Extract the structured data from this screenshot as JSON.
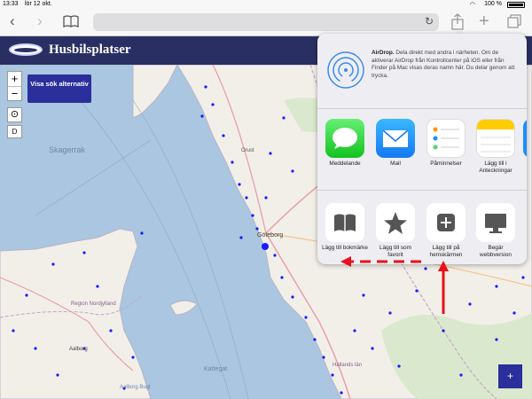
{
  "status_bar": {
    "time": "13:33",
    "day": "lör 12 okt.",
    "battery": "100 %"
  },
  "browser": {
    "back_icon": "chevron-left-icon",
    "forward_icon": "chevron-right-icon",
    "bookmarks_icon": "book-icon",
    "reload_icon": "reload-icon",
    "share_icon": "share-icon",
    "new_tab_icon": "plus-icon",
    "tabs_icon": "tabs-icon"
  },
  "site": {
    "title": "Husbilsplatser",
    "accent": "#2a2f63",
    "button_color": "#2a2f9c"
  },
  "map_controls": {
    "zoom_in": "+",
    "zoom_out": "−",
    "layer_label": "D",
    "search_button": "Visa sök alternativ"
  },
  "map_labels": {
    "skagerrak": "Skagerrak",
    "orust": "Orust",
    "goteborg": "Göteborg",
    "region_nordjylland": "Region Nordjylland",
    "aalborg": "Aalborg",
    "aalborg_bugt": "Aalborg Bugt",
    "kattegat": "Kattegat",
    "hallands_lan": "Hallands län"
  },
  "share_sheet": {
    "airdrop_title": "AirDrop.",
    "airdrop_text": "Dela direkt med andra i närheten. Om de aktiverar AirDrop från Kontrollcenter på iOS eller från Finder på Mac visas deras namn här. Du delar genom att trycka.",
    "apps": [
      {
        "label": "Meddelande",
        "icon": "messages-icon"
      },
      {
        "label": "Mail",
        "icon": "mail-icon"
      },
      {
        "label": "Påminnelser",
        "icon": "reminders-icon"
      },
      {
        "label": "Lägg till i Anteckningar",
        "icon": "notes-icon"
      }
    ],
    "actions": [
      {
        "label": "Lägg till bokmärke",
        "icon": "book-icon"
      },
      {
        "label": "Lägg till som favorit",
        "icon": "star-icon"
      },
      {
        "label": "Lägg till på hemskärmen",
        "icon": "plus-square-icon"
      },
      {
        "label": "Begär webbversion",
        "icon": "monitor-icon"
      }
    ]
  },
  "fab": {
    "label": "+"
  },
  "colors": {
    "annotation_red": "#e8101a",
    "marker_blue": "#1a1aff",
    "sea": "#aac6e0",
    "land": "#f2efe9"
  }
}
